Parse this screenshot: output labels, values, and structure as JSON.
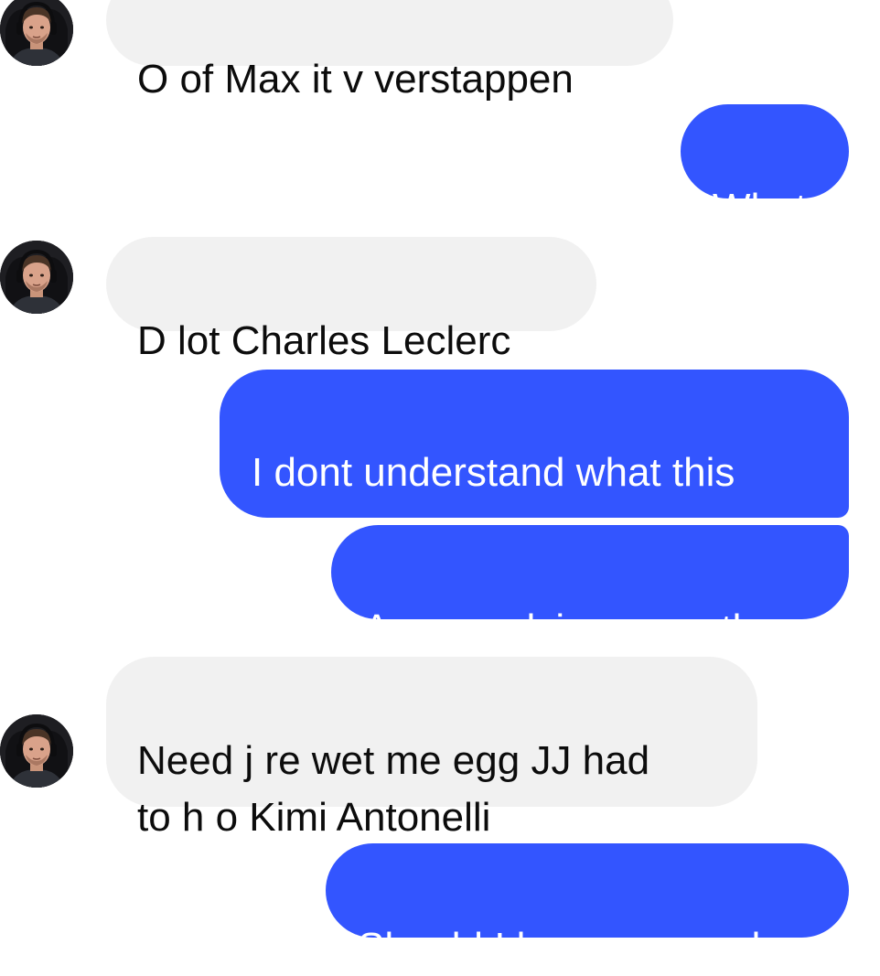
{
  "conversation": {
    "messages": [
      {
        "id": "m1",
        "direction": "received",
        "text": "O of Max it v verstappen"
      },
      {
        "id": "m2",
        "direction": "sent",
        "text": "What"
      },
      {
        "id": "m3",
        "direction": "received",
        "text": "D lot Charles Leclerc"
      },
      {
        "id": "m4",
        "direction": "sent",
        "text": "I dont understand what this\nmeans"
      },
      {
        "id": "m5",
        "direction": "sent",
        "text": "Are you dying or smth"
      },
      {
        "id": "m6",
        "direction": "received",
        "text": "Need j re wet me egg JJ had\nto h o Kimi Antonelli"
      },
      {
        "id": "m7",
        "direction": "sent",
        "text": "Should I be concerned"
      }
    ]
  },
  "theme": {
    "sent_bubble": "#3355ff",
    "received_bubble": "#f1f1f1",
    "background": "#ffffff"
  },
  "avatar": {
    "icon": "user-avatar-photo"
  }
}
